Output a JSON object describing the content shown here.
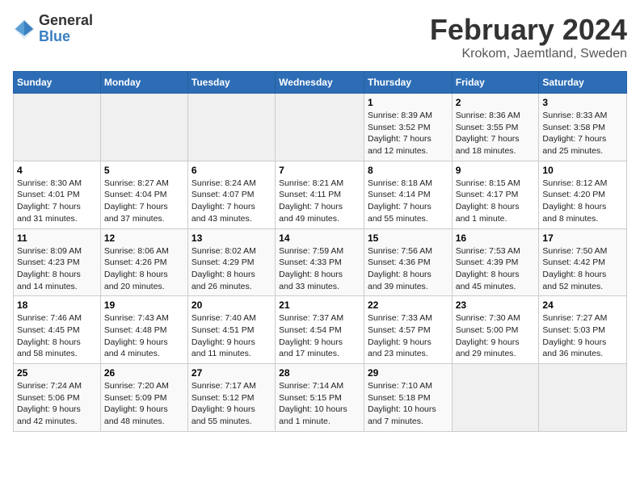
{
  "logo": {
    "general": "General",
    "blue": "Blue"
  },
  "title": "February 2024",
  "subtitle": "Krokom, Jaemtland, Sweden",
  "days_header": [
    "Sunday",
    "Monday",
    "Tuesday",
    "Wednesday",
    "Thursday",
    "Friday",
    "Saturday"
  ],
  "weeks": [
    [
      {
        "day": "",
        "info": ""
      },
      {
        "day": "",
        "info": ""
      },
      {
        "day": "",
        "info": ""
      },
      {
        "day": "",
        "info": ""
      },
      {
        "day": "1",
        "info": "Sunrise: 8:39 AM\nSunset: 3:52 PM\nDaylight: 7 hours\nand 12 minutes."
      },
      {
        "day": "2",
        "info": "Sunrise: 8:36 AM\nSunset: 3:55 PM\nDaylight: 7 hours\nand 18 minutes."
      },
      {
        "day": "3",
        "info": "Sunrise: 8:33 AM\nSunset: 3:58 PM\nDaylight: 7 hours\nand 25 minutes."
      }
    ],
    [
      {
        "day": "4",
        "info": "Sunrise: 8:30 AM\nSunset: 4:01 PM\nDaylight: 7 hours\nand 31 minutes."
      },
      {
        "day": "5",
        "info": "Sunrise: 8:27 AM\nSunset: 4:04 PM\nDaylight: 7 hours\nand 37 minutes."
      },
      {
        "day": "6",
        "info": "Sunrise: 8:24 AM\nSunset: 4:07 PM\nDaylight: 7 hours\nand 43 minutes."
      },
      {
        "day": "7",
        "info": "Sunrise: 8:21 AM\nSunset: 4:11 PM\nDaylight: 7 hours\nand 49 minutes."
      },
      {
        "day": "8",
        "info": "Sunrise: 8:18 AM\nSunset: 4:14 PM\nDaylight: 7 hours\nand 55 minutes."
      },
      {
        "day": "9",
        "info": "Sunrise: 8:15 AM\nSunset: 4:17 PM\nDaylight: 8 hours\nand 1 minute."
      },
      {
        "day": "10",
        "info": "Sunrise: 8:12 AM\nSunset: 4:20 PM\nDaylight: 8 hours\nand 8 minutes."
      }
    ],
    [
      {
        "day": "11",
        "info": "Sunrise: 8:09 AM\nSunset: 4:23 PM\nDaylight: 8 hours\nand 14 minutes."
      },
      {
        "day": "12",
        "info": "Sunrise: 8:06 AM\nSunset: 4:26 PM\nDaylight: 8 hours\nand 20 minutes."
      },
      {
        "day": "13",
        "info": "Sunrise: 8:02 AM\nSunset: 4:29 PM\nDaylight: 8 hours\nand 26 minutes."
      },
      {
        "day": "14",
        "info": "Sunrise: 7:59 AM\nSunset: 4:33 PM\nDaylight: 8 hours\nand 33 minutes."
      },
      {
        "day": "15",
        "info": "Sunrise: 7:56 AM\nSunset: 4:36 PM\nDaylight: 8 hours\nand 39 minutes."
      },
      {
        "day": "16",
        "info": "Sunrise: 7:53 AM\nSunset: 4:39 PM\nDaylight: 8 hours\nand 45 minutes."
      },
      {
        "day": "17",
        "info": "Sunrise: 7:50 AM\nSunset: 4:42 PM\nDaylight: 8 hours\nand 52 minutes."
      }
    ],
    [
      {
        "day": "18",
        "info": "Sunrise: 7:46 AM\nSunset: 4:45 PM\nDaylight: 8 hours\nand 58 minutes."
      },
      {
        "day": "19",
        "info": "Sunrise: 7:43 AM\nSunset: 4:48 PM\nDaylight: 9 hours\nand 4 minutes."
      },
      {
        "day": "20",
        "info": "Sunrise: 7:40 AM\nSunset: 4:51 PM\nDaylight: 9 hours\nand 11 minutes."
      },
      {
        "day": "21",
        "info": "Sunrise: 7:37 AM\nSunset: 4:54 PM\nDaylight: 9 hours\nand 17 minutes."
      },
      {
        "day": "22",
        "info": "Sunrise: 7:33 AM\nSunset: 4:57 PM\nDaylight: 9 hours\nand 23 minutes."
      },
      {
        "day": "23",
        "info": "Sunrise: 7:30 AM\nSunset: 5:00 PM\nDaylight: 9 hours\nand 29 minutes."
      },
      {
        "day": "24",
        "info": "Sunrise: 7:27 AM\nSunset: 5:03 PM\nDaylight: 9 hours\nand 36 minutes."
      }
    ],
    [
      {
        "day": "25",
        "info": "Sunrise: 7:24 AM\nSunset: 5:06 PM\nDaylight: 9 hours\nand 42 minutes."
      },
      {
        "day": "26",
        "info": "Sunrise: 7:20 AM\nSunset: 5:09 PM\nDaylight: 9 hours\nand 48 minutes."
      },
      {
        "day": "27",
        "info": "Sunrise: 7:17 AM\nSunset: 5:12 PM\nDaylight: 9 hours\nand 55 minutes."
      },
      {
        "day": "28",
        "info": "Sunrise: 7:14 AM\nSunset: 5:15 PM\nDaylight: 10 hours\nand 1 minute."
      },
      {
        "day": "29",
        "info": "Sunrise: 7:10 AM\nSunset: 5:18 PM\nDaylight: 10 hours\nand 7 minutes."
      },
      {
        "day": "",
        "info": ""
      },
      {
        "day": "",
        "info": ""
      }
    ]
  ]
}
